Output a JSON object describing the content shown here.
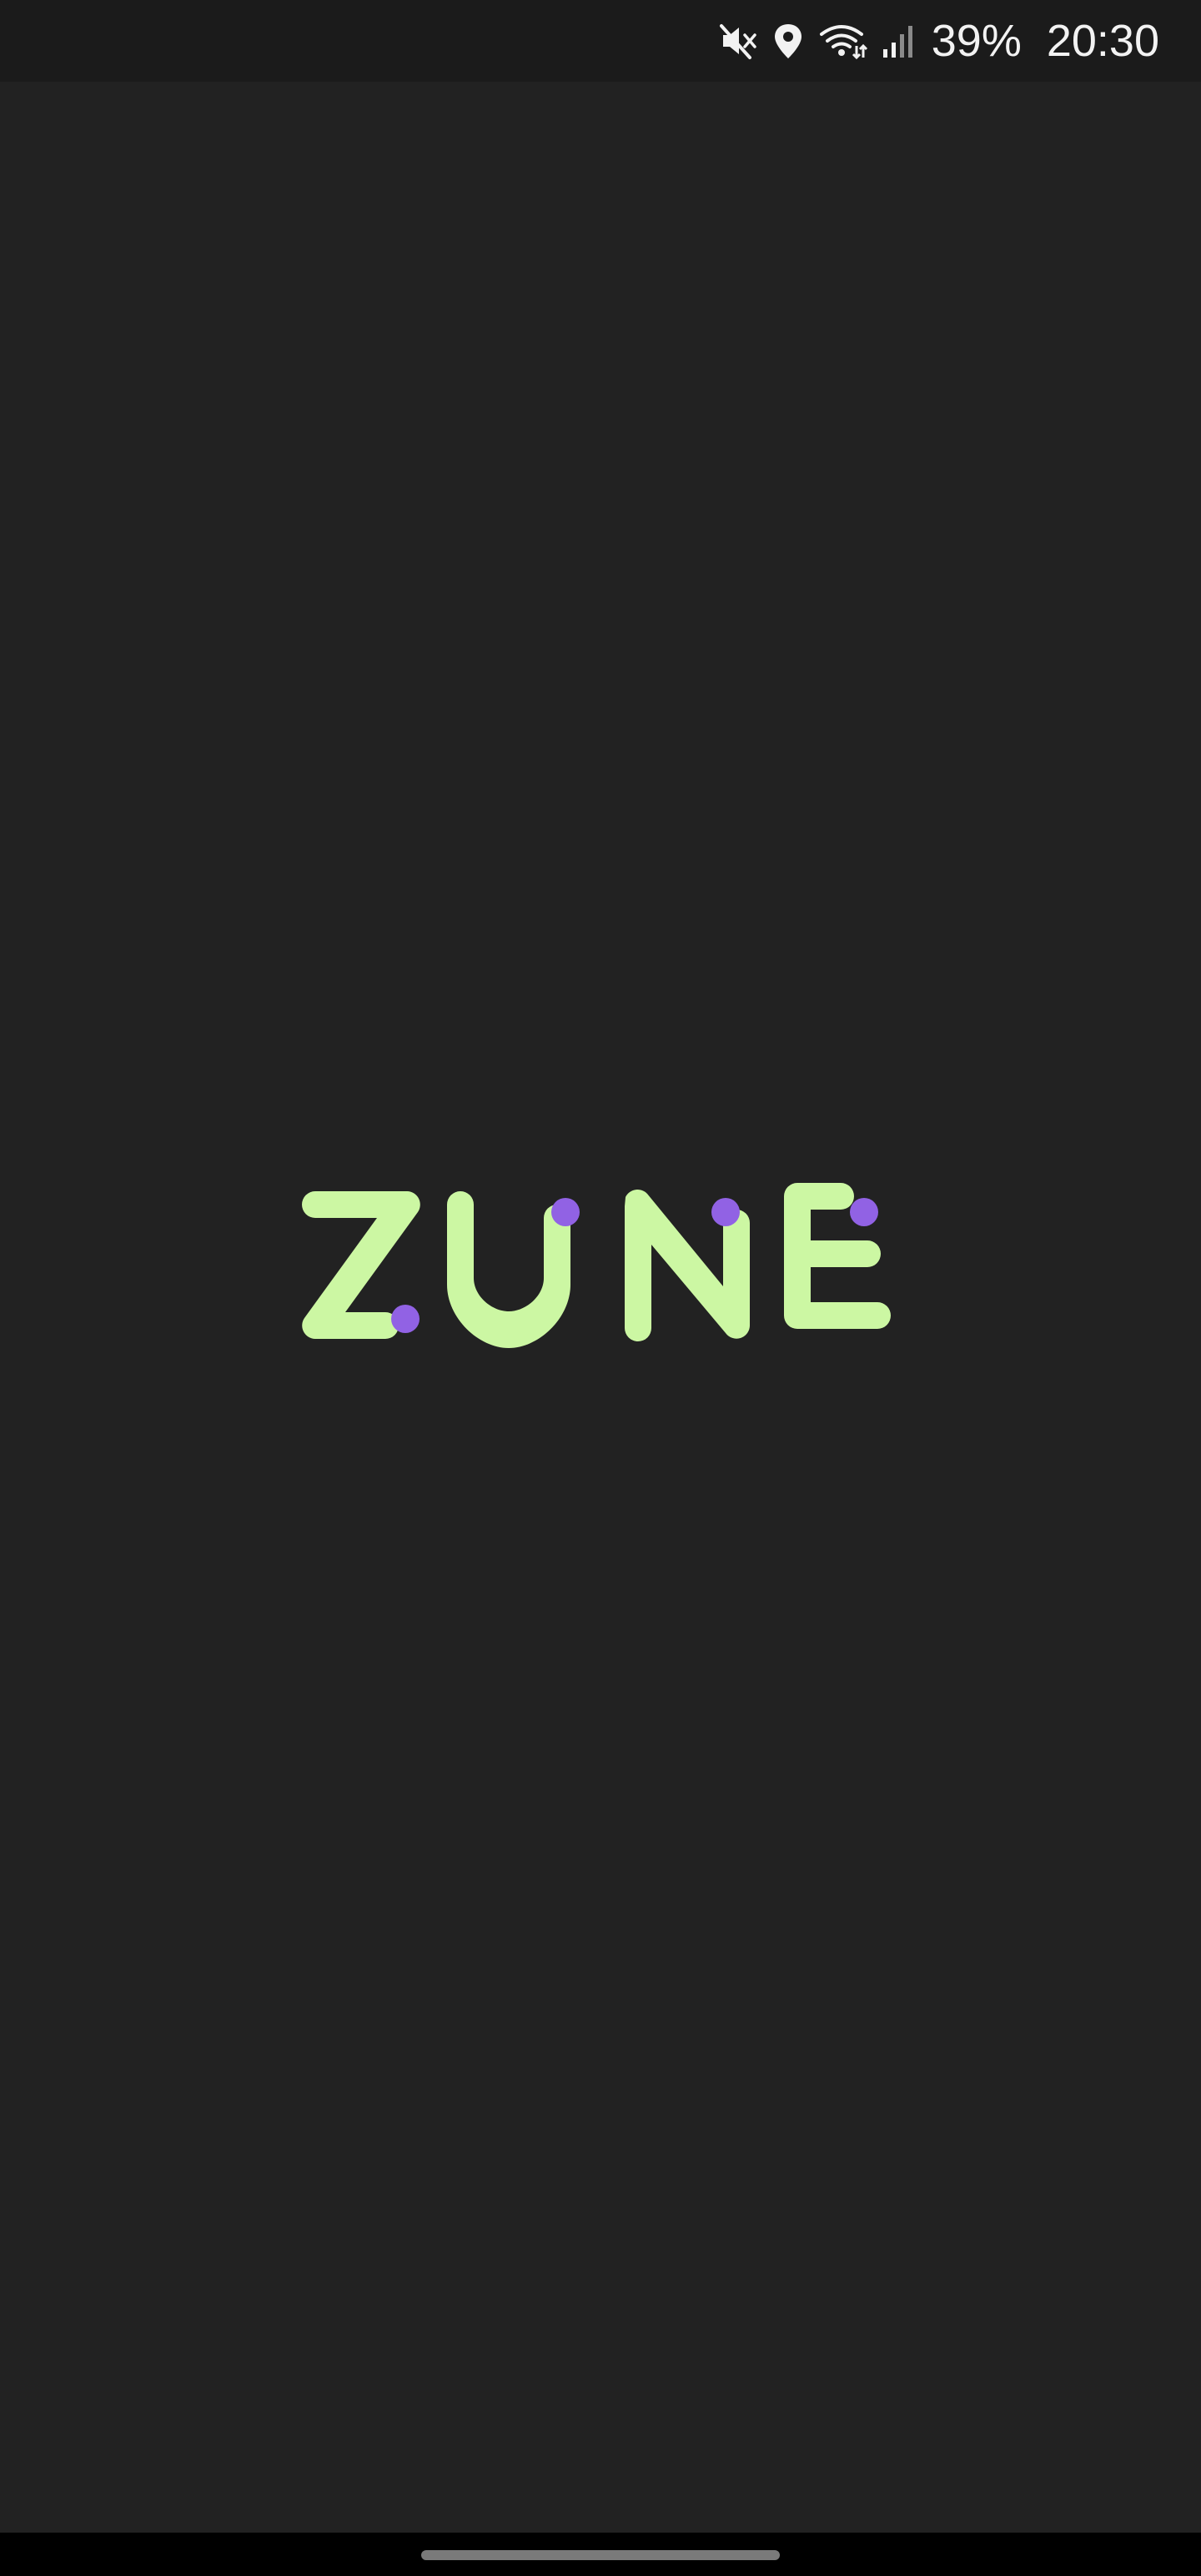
{
  "status_bar": {
    "battery": "39%",
    "time": "20:30",
    "icons": [
      "mute-icon",
      "location-icon",
      "wifi-icon",
      "signal-icon"
    ]
  },
  "splash": {
    "logo_text": "ZUNE",
    "logo_colors": {
      "letters": "#CCF7A3",
      "dots": "#9162E4"
    },
    "background": "#222222"
  }
}
